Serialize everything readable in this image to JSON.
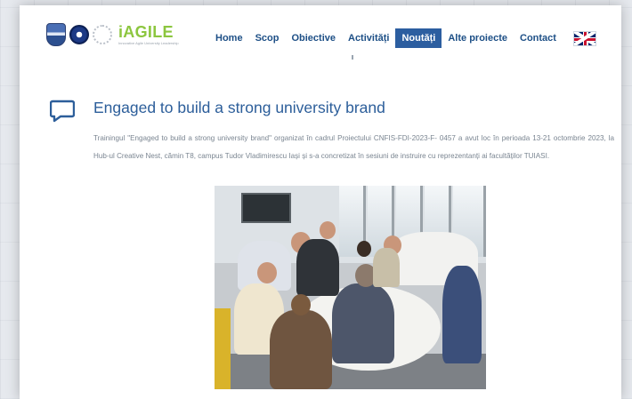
{
  "header": {
    "logo_name": "iAGILE",
    "logo_tagline": "Innovative Agile University Leadership"
  },
  "nav": {
    "items": [
      {
        "label": "Home"
      },
      {
        "label": "Scop"
      },
      {
        "label": "Obiective"
      },
      {
        "label": "Activități"
      },
      {
        "label": "Noutăți",
        "active": true
      },
      {
        "label": "Alte proiecte"
      },
      {
        "label": "Contact"
      }
    ],
    "language_flag": "uk-flag-icon"
  },
  "article": {
    "icon": "speech-bubble-icon",
    "title": "Engaged to build a strong university brand",
    "body": "Trainingul \"Engaged to build a strong university brand\" organizat în cadrul Proiectului CNFIS-FDI-2023-F- 0457 a avut loc în perioada 13-21 octombrie 2023, la Hub-ul Creative Nest, cămin T8, campus Tudor Vladimirescu Iași și s-a concretizat în sesiuni de instruire cu reprezentanți ai facultăților TUIASI."
  },
  "colors": {
    "nav_text": "#1d4f86",
    "nav_active_bg": "#2c5ea0",
    "title": "#2c5e9a",
    "logo_green": "#8cc63f",
    "body_text": "#7a8591"
  }
}
